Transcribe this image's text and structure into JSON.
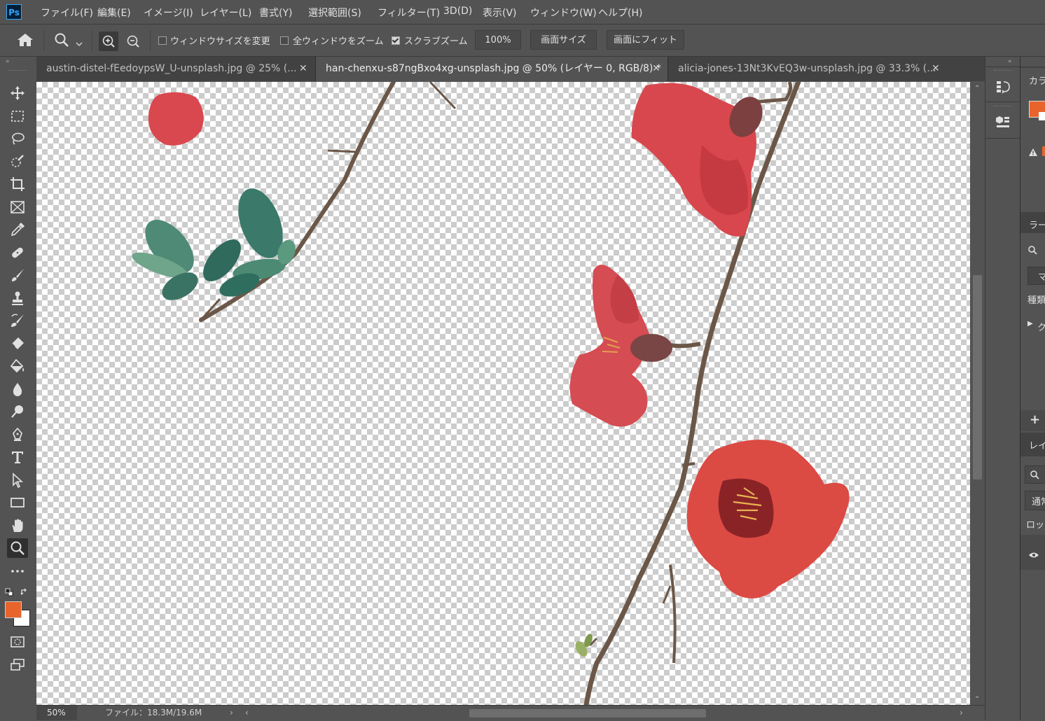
{
  "app": {
    "logo": "Ps"
  },
  "menu": [
    "ファイル(F)",
    "編集(E)",
    "イメージ(I)",
    "レイヤー(L)",
    "書式(Y)",
    "選択範囲(S)",
    "フィルター(T)",
    "3D(D)",
    "表示(V)",
    "ウィンドウ(W)",
    "ヘルプ(H)"
  ],
  "options": {
    "resize_windows_label": "ウィンドウサイズを変更",
    "resize_windows_checked": false,
    "zoom_all_label": "全ウィンドウをズーム",
    "zoom_all_checked": false,
    "scrubby_zoom_label": "スクラブズーム",
    "scrubby_zoom_checked": true,
    "zoom_value": "100%",
    "fit_screen_label": "画面サイズ",
    "fill_screen_label": "画面にフィット"
  },
  "tabs": [
    {
      "label": "austin-distel-fEedoypsW_U-unsplash.jpg @ 25% (...",
      "active": false
    },
    {
      "label": "han-chenxu-s87ngBxo4xg-unsplash.jpg @ 50% (レイヤー 0, RGB/8) *",
      "active": true
    },
    {
      "label": "alicia-jones-13Nt3KvEQ3w-unsplash.jpg @ 33.3% (...",
      "active": false
    }
  ],
  "status": {
    "zoom": "50%",
    "file_info": "ファイル：18.3M/19.6M"
  },
  "colors": {
    "foreground": "#e8642c",
    "background": "#ffffff",
    "accent": "#31a8ff"
  },
  "tools": [
    "move-icon",
    "marquee-icon",
    "lasso-icon",
    "quick-select-icon",
    "crop-icon",
    "frame-icon",
    "eyedropper-icon",
    "healing-icon",
    "brush-icon",
    "stamp-icon",
    "history-brush-icon",
    "eraser-icon",
    "bucket-icon",
    "blur-icon",
    "dodge-icon",
    "pen-icon",
    "type-icon",
    "path-select-icon",
    "rectangle-icon",
    "hand-icon",
    "zoom-icon",
    "more-icon"
  ],
  "right_panel": {
    "color_tab": "カラ",
    "libraries_tab": "ラー",
    "lib_item1": "マ",
    "kind_label": "種類",
    "group_label": "ク",
    "layers_tab": "レイ",
    "blend_mode": "通常",
    "lock_label": "ロック"
  }
}
